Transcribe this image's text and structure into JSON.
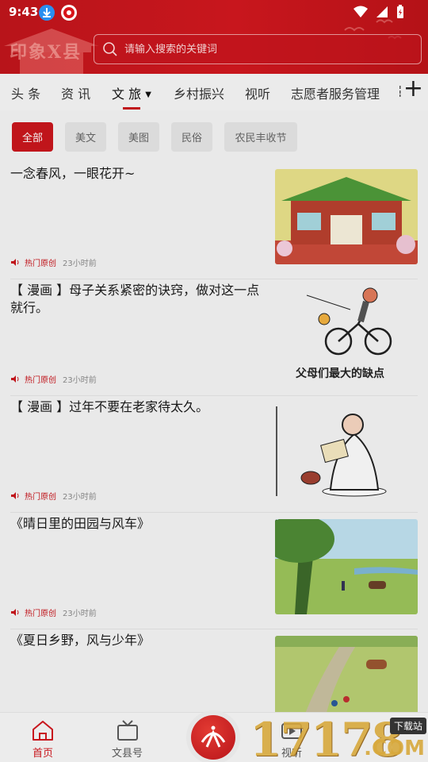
{
  "status_bar": {
    "time": "9:43"
  },
  "header": {
    "logo_text": "印象X县",
    "search_placeholder": "请输入搜索的关键词"
  },
  "tabs": [
    {
      "label": "头 条",
      "active": false
    },
    {
      "label": "资 讯",
      "active": false
    },
    {
      "label": "文 旅",
      "active": true,
      "has_dropdown": true
    },
    {
      "label": "乡村振兴",
      "active": false
    },
    {
      "label": "视听",
      "active": false
    },
    {
      "label": "志愿者服务管理",
      "active": false
    }
  ],
  "chips": [
    {
      "label": "全部",
      "active": true
    },
    {
      "label": "美文",
      "active": false
    },
    {
      "label": "美图",
      "active": false
    },
    {
      "label": "民俗",
      "active": false
    },
    {
      "label": "农民丰收节",
      "active": false
    }
  ],
  "articles": [
    {
      "title": "一念春风，一眼花开~",
      "tag": "热门原创",
      "time": "23小时前",
      "thumb": "temple-painting"
    },
    {
      "title": "【 漫画 】母子关系紧密的诀窍，做对这一点就行。",
      "tag": "热门原创",
      "time": "23小时前",
      "thumb": "cartoon-bicycle",
      "thumb_caption": "父母们最大的缺点"
    },
    {
      "title": "【 漫画 】过年不要在老家待太久。",
      "tag": "热门原创",
      "time": "23小时前",
      "thumb": "cartoon-reading"
    },
    {
      "title": "《晴日里的田园与风车》",
      "tag": "热门原创",
      "time": "23小时前",
      "thumb": "countryside-field"
    },
    {
      "title": "《夏日乡野，风与少年》",
      "tag": "",
      "time": "",
      "thumb": "summer-field"
    }
  ],
  "bottom_nav": [
    {
      "label": "首页",
      "icon": "home-icon",
      "active": true
    },
    {
      "label": "文县号",
      "icon": "tv-icon",
      "active": false
    },
    {
      "label": "",
      "icon": "center-logo",
      "active": false
    },
    {
      "label": "视听",
      "icon": "video-icon",
      "active": false
    }
  ],
  "watermark": {
    "text": "17178",
    "download": "下载站",
    "com": ".COM"
  },
  "colors": {
    "brand_red": "#c8161d",
    "tag_red": "#c8161d",
    "muted": "#8a8a8a"
  }
}
